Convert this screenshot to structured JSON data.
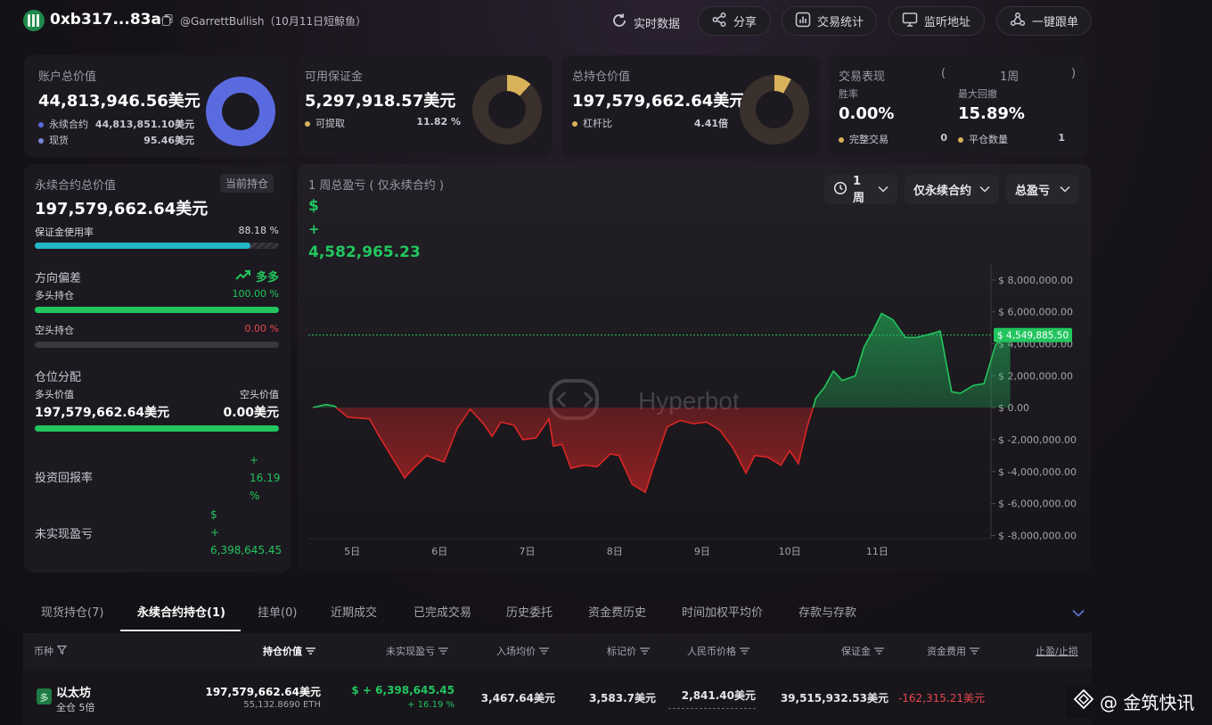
{
  "header": {
    "address": "0xb317...83ae",
    "handle": "@GarrettBullish",
    "note": "（10月11日短鲸鱼）",
    "buttons": {
      "realtime": "实时数据",
      "share": "分享",
      "trade_stats": "交易统计",
      "monitor": "监听地址",
      "copy_trade": "一键跟单"
    }
  },
  "summary": {
    "account_total": {
      "label": "账户总价值",
      "value": "44,813,946.56美元",
      "rows": [
        {
          "label": "永续合约",
          "value": "44,813,851.10美元",
          "color": "#5a6be0"
        },
        {
          "label": "现货",
          "value": "95.46美元",
          "color": "#7a86d6"
        }
      ]
    },
    "available_margin": {
      "label": "可用保证金",
      "value": "5,297,918.57美元",
      "row_label": "可提取",
      "row_value": "11.82 %",
      "fill_fraction": 0.1182,
      "color": "#d9b35a"
    },
    "total_position": {
      "label": "总持仓价值",
      "value": "197,579,662.64美元",
      "row_label": "杠杆比",
      "row_value": "4.41倍",
      "color": "#d9b35a"
    },
    "performance": {
      "label": "交易表现",
      "paren_open": "(",
      "period": "1周",
      "paren_close": ")",
      "win_rate_label": "胜率",
      "win_rate": "0.00%",
      "max_drawdown_label": "最大回撤",
      "max_drawdown": "15.89%",
      "completed_label": "完整交易",
      "completed_value": "0",
      "closed_label": "平仓数量",
      "closed_value": "1"
    }
  },
  "perp": {
    "title": "永续合约总价值",
    "badge": "当前持仓",
    "value": "197,579,662.64美元",
    "margin_usage_label": "保证金使用率",
    "margin_usage_value": "88.18 %",
    "margin_usage_fraction": 0.8818,
    "direction_label": "方向偏差",
    "direction_value": "多多",
    "long_label": "多头持仓",
    "long_value": "100.00 %",
    "short_label": "空头持仓",
    "short_value": "0.00 %",
    "alloc_label": "仓位分配",
    "long_value_label": "多头价值",
    "short_value_label": "空头价值",
    "long_amount": "197,579,662.64美元",
    "short_amount": "0.00美元",
    "roi_label": "投资回报率",
    "roi_sign": "+",
    "roi_num": "16.19",
    "roi_pct": "%",
    "upnl_label": "未实现盈亏",
    "upnl_currency": "$",
    "upnl_sign": "+",
    "upnl_num": "6,398,645.45"
  },
  "chart_panel": {
    "title": "1 周总盈亏 ( 仅永续合约 )",
    "currency": "$",
    "sign": "+",
    "total": "4,582,965.23",
    "controls": {
      "period": "1周",
      "scope": "仅永续合约",
      "metric": "总盈亏"
    },
    "watermark": "Hyperbot",
    "current_label": "$ 4,549,885.50"
  },
  "chart_data": {
    "type": "area",
    "title": "1 周总盈亏 ( 仅永续合约 )",
    "xlabel": "",
    "ylabel": "",
    "x_ticks": [
      "5日",
      "6日",
      "7日",
      "8日",
      "9日",
      "10日",
      "11日"
    ],
    "x_tick_positions": [
      0.5,
      1.5,
      2.5,
      3.5,
      4.5,
      5.5,
      6.5
    ],
    "y_ticks": [
      "$ 8,000,000.00",
      "$ 6,000,000.00",
      "$ 4,000,000.00",
      "$ 2,000,000.00",
      "$ 0.00",
      "$ -2,000,000.00",
      "$ -4,000,000.00",
      "$ -6,000,000.00",
      "$ -8,000,000.00"
    ],
    "y_tick_values": [
      8000000,
      6000000,
      4000000,
      2000000,
      0,
      -2000000,
      -4000000,
      -6000000,
      -8000000
    ],
    "xlim": [
      0,
      7.8
    ],
    "ylim": [
      -8200000,
      9000000
    ],
    "current_value": 4549885.5,
    "positive_color": "#22c55e",
    "negative_color": "#dc2626",
    "points": [
      [
        0.05,
        0
      ],
      [
        0.2,
        200000
      ],
      [
        0.3,
        100000
      ],
      [
        0.45,
        -600000
      ],
      [
        0.7,
        -700000
      ],
      [
        0.8,
        -1700000
      ],
      [
        1.0,
        -3500000
      ],
      [
        1.1,
        -4400000
      ],
      [
        1.2,
        -3800000
      ],
      [
        1.35,
        -3000000
      ],
      [
        1.45,
        -3200000
      ],
      [
        1.55,
        -3400000
      ],
      [
        1.7,
        -1300000
      ],
      [
        1.85,
        -100000
      ],
      [
        2.0,
        -1000000
      ],
      [
        2.1,
        -1800000
      ],
      [
        2.2,
        -900000
      ],
      [
        2.35,
        -1100000
      ],
      [
        2.45,
        -2000000
      ],
      [
        2.6,
        -1900000
      ],
      [
        2.75,
        -700000
      ],
      [
        2.8,
        -2400000
      ],
      [
        2.9,
        -2300000
      ],
      [
        3.0,
        -3800000
      ],
      [
        3.15,
        -3600000
      ],
      [
        3.3,
        -3700000
      ],
      [
        3.45,
        -2900000
      ],
      [
        3.55,
        -3000000
      ],
      [
        3.7,
        -4800000
      ],
      [
        3.85,
        -5300000
      ],
      [
        3.95,
        -3600000
      ],
      [
        4.1,
        -1200000
      ],
      [
        4.25,
        -800000
      ],
      [
        4.4,
        -1000000
      ],
      [
        4.55,
        -900000
      ],
      [
        4.7,
        -1400000
      ],
      [
        4.85,
        -2500000
      ],
      [
        5.0,
        -4100000
      ],
      [
        5.1,
        -3000000
      ],
      [
        5.25,
        -3100000
      ],
      [
        5.4,
        -3600000
      ],
      [
        5.5,
        -2700000
      ],
      [
        5.6,
        -3500000
      ],
      [
        5.7,
        -1200000
      ],
      [
        5.8,
        600000
      ],
      [
        5.9,
        1300000
      ],
      [
        6.0,
        2300000
      ],
      [
        6.1,
        1700000
      ],
      [
        6.25,
        2000000
      ],
      [
        6.35,
        3800000
      ],
      [
        6.45,
        4800000
      ],
      [
        6.55,
        5900000
      ],
      [
        6.68,
        5500000
      ],
      [
        6.82,
        4400000
      ],
      [
        6.95,
        4400000
      ],
      [
        7.1,
        4600000
      ],
      [
        7.22,
        4800000
      ],
      [
        7.35,
        1000000
      ],
      [
        7.45,
        900000
      ],
      [
        7.6,
        1400000
      ],
      [
        7.72,
        1500000
      ],
      [
        7.85,
        3900000
      ],
      [
        7.95,
        4600000
      ],
      [
        8.02,
        4549885
      ]
    ]
  },
  "tabs": [
    {
      "label": "现货持仓(7)"
    },
    {
      "label": "永续合约持仓(1)",
      "active": true
    },
    {
      "label": "挂单(0)"
    },
    {
      "label": "近期成交"
    },
    {
      "label": "已完成交易"
    },
    {
      "label": "历史委托"
    },
    {
      "label": "资金费历史"
    },
    {
      "label": "时间加权平均价"
    },
    {
      "label": "存款与存款"
    }
  ],
  "table": {
    "headers": [
      "币种",
      "持仓价值",
      "未实现盈亏",
      "入场均价",
      "标记价",
      "人民币价格",
      "保证金",
      "资金费用",
      "止盈/止损"
    ],
    "row": {
      "icon_char": "多",
      "coin": "以太坊",
      "mode": "全仓 5倍",
      "position_value": "197,579,662.64美元",
      "position_size": "55,132.8690 ETH",
      "upnl": "$ + 6,398,645.45",
      "upnl_pct": "+ 16.19 %",
      "entry": "3,467.64美元",
      "mark": "3,583.7美元",
      "cny_price": "2,841.40美元",
      "margin": "39,515,932.53美元",
      "funding": "-162,315.21美元"
    }
  },
  "watermark_brand": "@ 金筑快讯"
}
